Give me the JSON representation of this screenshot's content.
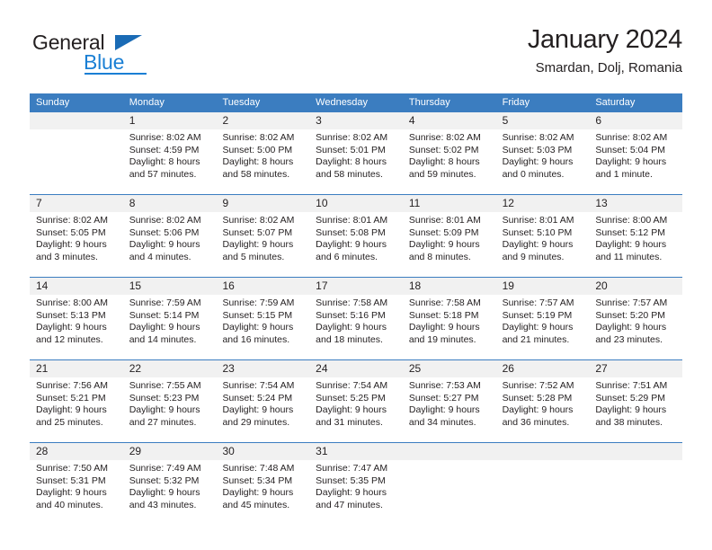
{
  "brand": {
    "name_part1": "General",
    "name_part2": "Blue",
    "accent_color": "#1a7fd4",
    "triangle_color": "#1a6bb5"
  },
  "header": {
    "title": "January 2024",
    "subtitle": "Smardan, Dolj, Romania"
  },
  "theme": {
    "header_bg": "#3b7dc0",
    "datebar_bg": "#f1f1f1",
    "text_color": "#231f20"
  },
  "weekdays": [
    "Sunday",
    "Monday",
    "Tuesday",
    "Wednesday",
    "Thursday",
    "Friday",
    "Saturday"
  ],
  "weeks": [
    {
      "days": [
        {
          "num": "",
          "sunrise": "",
          "sunset": "",
          "daylight1": "",
          "daylight2": "",
          "empty": true
        },
        {
          "num": "1",
          "sunrise": "Sunrise: 8:02 AM",
          "sunset": "Sunset: 4:59 PM",
          "daylight1": "Daylight: 8 hours",
          "daylight2": "and 57 minutes."
        },
        {
          "num": "2",
          "sunrise": "Sunrise: 8:02 AM",
          "sunset": "Sunset: 5:00 PM",
          "daylight1": "Daylight: 8 hours",
          "daylight2": "and 58 minutes."
        },
        {
          "num": "3",
          "sunrise": "Sunrise: 8:02 AM",
          "sunset": "Sunset: 5:01 PM",
          "daylight1": "Daylight: 8 hours",
          "daylight2": "and 58 minutes."
        },
        {
          "num": "4",
          "sunrise": "Sunrise: 8:02 AM",
          "sunset": "Sunset: 5:02 PM",
          "daylight1": "Daylight: 8 hours",
          "daylight2": "and 59 minutes."
        },
        {
          "num": "5",
          "sunrise": "Sunrise: 8:02 AM",
          "sunset": "Sunset: 5:03 PM",
          "daylight1": "Daylight: 9 hours",
          "daylight2": "and 0 minutes."
        },
        {
          "num": "6",
          "sunrise": "Sunrise: 8:02 AM",
          "sunset": "Sunset: 5:04 PM",
          "daylight1": "Daylight: 9 hours",
          "daylight2": "and 1 minute."
        }
      ]
    },
    {
      "days": [
        {
          "num": "7",
          "sunrise": "Sunrise: 8:02 AM",
          "sunset": "Sunset: 5:05 PM",
          "daylight1": "Daylight: 9 hours",
          "daylight2": "and 3 minutes."
        },
        {
          "num": "8",
          "sunrise": "Sunrise: 8:02 AM",
          "sunset": "Sunset: 5:06 PM",
          "daylight1": "Daylight: 9 hours",
          "daylight2": "and 4 minutes."
        },
        {
          "num": "9",
          "sunrise": "Sunrise: 8:02 AM",
          "sunset": "Sunset: 5:07 PM",
          "daylight1": "Daylight: 9 hours",
          "daylight2": "and 5 minutes."
        },
        {
          "num": "10",
          "sunrise": "Sunrise: 8:01 AM",
          "sunset": "Sunset: 5:08 PM",
          "daylight1": "Daylight: 9 hours",
          "daylight2": "and 6 minutes."
        },
        {
          "num": "11",
          "sunrise": "Sunrise: 8:01 AM",
          "sunset": "Sunset: 5:09 PM",
          "daylight1": "Daylight: 9 hours",
          "daylight2": "and 8 minutes."
        },
        {
          "num": "12",
          "sunrise": "Sunrise: 8:01 AM",
          "sunset": "Sunset: 5:10 PM",
          "daylight1": "Daylight: 9 hours",
          "daylight2": "and 9 minutes."
        },
        {
          "num": "13",
          "sunrise": "Sunrise: 8:00 AM",
          "sunset": "Sunset: 5:12 PM",
          "daylight1": "Daylight: 9 hours",
          "daylight2": "and 11 minutes."
        }
      ]
    },
    {
      "days": [
        {
          "num": "14",
          "sunrise": "Sunrise: 8:00 AM",
          "sunset": "Sunset: 5:13 PM",
          "daylight1": "Daylight: 9 hours",
          "daylight2": "and 12 minutes."
        },
        {
          "num": "15",
          "sunrise": "Sunrise: 7:59 AM",
          "sunset": "Sunset: 5:14 PM",
          "daylight1": "Daylight: 9 hours",
          "daylight2": "and 14 minutes."
        },
        {
          "num": "16",
          "sunrise": "Sunrise: 7:59 AM",
          "sunset": "Sunset: 5:15 PM",
          "daylight1": "Daylight: 9 hours",
          "daylight2": "and 16 minutes."
        },
        {
          "num": "17",
          "sunrise": "Sunrise: 7:58 AM",
          "sunset": "Sunset: 5:16 PM",
          "daylight1": "Daylight: 9 hours",
          "daylight2": "and 18 minutes."
        },
        {
          "num": "18",
          "sunrise": "Sunrise: 7:58 AM",
          "sunset": "Sunset: 5:18 PM",
          "daylight1": "Daylight: 9 hours",
          "daylight2": "and 19 minutes."
        },
        {
          "num": "19",
          "sunrise": "Sunrise: 7:57 AM",
          "sunset": "Sunset: 5:19 PM",
          "daylight1": "Daylight: 9 hours",
          "daylight2": "and 21 minutes."
        },
        {
          "num": "20",
          "sunrise": "Sunrise: 7:57 AM",
          "sunset": "Sunset: 5:20 PM",
          "daylight1": "Daylight: 9 hours",
          "daylight2": "and 23 minutes."
        }
      ]
    },
    {
      "days": [
        {
          "num": "21",
          "sunrise": "Sunrise: 7:56 AM",
          "sunset": "Sunset: 5:21 PM",
          "daylight1": "Daylight: 9 hours",
          "daylight2": "and 25 minutes."
        },
        {
          "num": "22",
          "sunrise": "Sunrise: 7:55 AM",
          "sunset": "Sunset: 5:23 PM",
          "daylight1": "Daylight: 9 hours",
          "daylight2": "and 27 minutes."
        },
        {
          "num": "23",
          "sunrise": "Sunrise: 7:54 AM",
          "sunset": "Sunset: 5:24 PM",
          "daylight1": "Daylight: 9 hours",
          "daylight2": "and 29 minutes."
        },
        {
          "num": "24",
          "sunrise": "Sunrise: 7:54 AM",
          "sunset": "Sunset: 5:25 PM",
          "daylight1": "Daylight: 9 hours",
          "daylight2": "and 31 minutes."
        },
        {
          "num": "25",
          "sunrise": "Sunrise: 7:53 AM",
          "sunset": "Sunset: 5:27 PM",
          "daylight1": "Daylight: 9 hours",
          "daylight2": "and 34 minutes."
        },
        {
          "num": "26",
          "sunrise": "Sunrise: 7:52 AM",
          "sunset": "Sunset: 5:28 PM",
          "daylight1": "Daylight: 9 hours",
          "daylight2": "and 36 minutes."
        },
        {
          "num": "27",
          "sunrise": "Sunrise: 7:51 AM",
          "sunset": "Sunset: 5:29 PM",
          "daylight1": "Daylight: 9 hours",
          "daylight2": "and 38 minutes."
        }
      ]
    },
    {
      "days": [
        {
          "num": "28",
          "sunrise": "Sunrise: 7:50 AM",
          "sunset": "Sunset: 5:31 PM",
          "daylight1": "Daylight: 9 hours",
          "daylight2": "and 40 minutes."
        },
        {
          "num": "29",
          "sunrise": "Sunrise: 7:49 AM",
          "sunset": "Sunset: 5:32 PM",
          "daylight1": "Daylight: 9 hours",
          "daylight2": "and 43 minutes."
        },
        {
          "num": "30",
          "sunrise": "Sunrise: 7:48 AM",
          "sunset": "Sunset: 5:34 PM",
          "daylight1": "Daylight: 9 hours",
          "daylight2": "and 45 minutes."
        },
        {
          "num": "31",
          "sunrise": "Sunrise: 7:47 AM",
          "sunset": "Sunset: 5:35 PM",
          "daylight1": "Daylight: 9 hours",
          "daylight2": "and 47 minutes."
        },
        {
          "num": "",
          "sunrise": "",
          "sunset": "",
          "daylight1": "",
          "daylight2": "",
          "empty": true
        },
        {
          "num": "",
          "sunrise": "",
          "sunset": "",
          "daylight1": "",
          "daylight2": "",
          "empty": true
        },
        {
          "num": "",
          "sunrise": "",
          "sunset": "",
          "daylight1": "",
          "daylight2": "",
          "empty": true
        }
      ]
    }
  ]
}
